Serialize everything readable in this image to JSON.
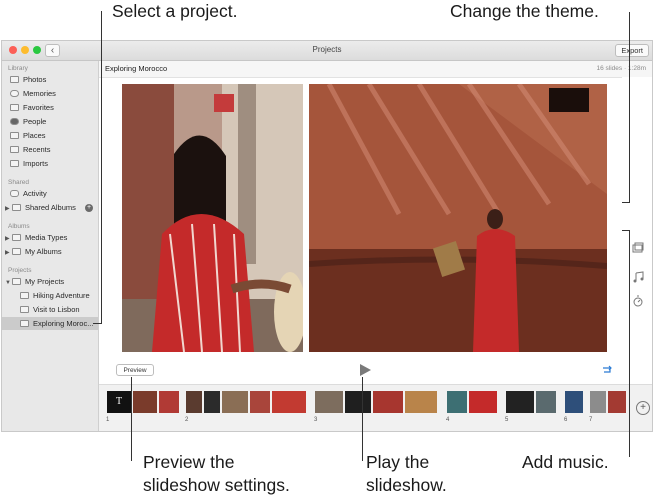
{
  "callouts": {
    "select_project": "Select a project.",
    "change_theme": "Change the theme.",
    "preview_line1": "Preview the",
    "preview_line2": "slideshow settings.",
    "play_line1": "Play the",
    "play_line2": "slideshow.",
    "add_music": "Add music."
  },
  "window": {
    "title": "Projects",
    "export_label": "Export"
  },
  "sidebar": {
    "library_header": "Library",
    "library": [
      "Photos",
      "Memories",
      "Favorites",
      "People",
      "Places",
      "Recents",
      "Imports"
    ],
    "shared_header": "Shared",
    "shared": [
      "Activity",
      "Shared Albums"
    ],
    "albums_header": "Albums",
    "albums": [
      "Media Types",
      "My Albums"
    ],
    "projects_header": "Projects",
    "projects_root": "My Projects",
    "projects": [
      "Hiking Adventure",
      "Visit to Lisbon",
      "Exploring Moroc..."
    ],
    "selected_project_index": 2
  },
  "project": {
    "title": "Exploring Morocco",
    "meta": "16 slides · 1:28m"
  },
  "controls": {
    "preview_label": "Preview",
    "add_icon": "plus-icon"
  },
  "filmstrip": {
    "group_numbers": [
      "1",
      "2",
      "3",
      "4",
      "5",
      "6",
      "7"
    ]
  },
  "theme_colors": {
    "sidebar_bg": "#e8e8e8",
    "accent": "#2a7bd4",
    "red_dress": "#c42a2a"
  }
}
